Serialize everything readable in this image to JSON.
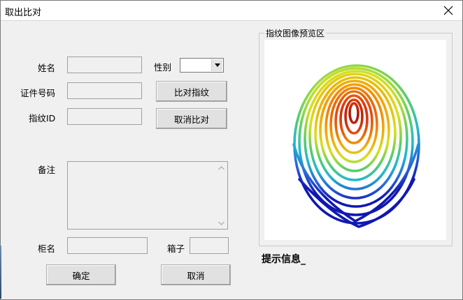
{
  "window": {
    "title": "取出比对"
  },
  "form": {
    "name_label": "姓名",
    "gender_label": "性别",
    "gender_value": "",
    "id_label": "证件号码",
    "finger_id_label": "指纹ID",
    "remarks_label": "备注",
    "cabinet_label": "柜名",
    "box_label": "箱子",
    "name_value": "",
    "id_value": "",
    "finger_id_value": "",
    "remarks_value": "",
    "cabinet_value": "",
    "box_value": ""
  },
  "buttons": {
    "compare": "比对指纹",
    "cancel_compare": "取消比对",
    "ok": "确定",
    "cancel": "取消"
  },
  "preview": {
    "group_title": "指纹图像预览区"
  },
  "hint": "提示信息_",
  "colors": {
    "ridge_core": "#b01010",
    "ridge_mid": "#f0a000",
    "ridge_outer": "#2030c0"
  }
}
